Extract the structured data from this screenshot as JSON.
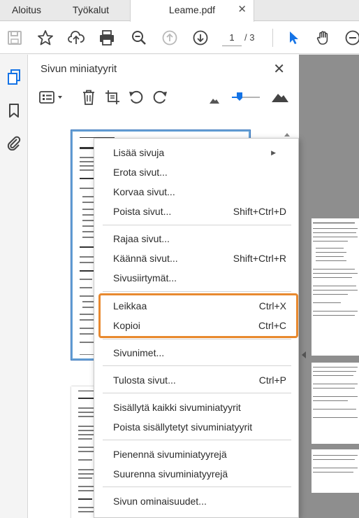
{
  "tabs": {
    "home": "Aloitus",
    "tools": "Työkalut",
    "document": "Leame.pdf",
    "close": "✕"
  },
  "toolbar": {
    "icons": [
      "save-icon",
      "star-icon",
      "upload-icon",
      "print-icon",
      "zoom-out-icon",
      "page-up-icon",
      "page-down-icon",
      "select-cursor-icon",
      "hand-icon",
      "zoom-minus-icon"
    ],
    "page_current": "1",
    "page_total": "/ 3",
    "accent": "#1473e6"
  },
  "panel": {
    "title": "Sivun miniatyyrit",
    "close": "✕",
    "tools": [
      "options-icon",
      "delete-icon",
      "crop-icon",
      "rotate-ccw-icon",
      "rotate-cw-icon",
      "small-mountain-icon",
      "zoom-slider",
      "large-mountain-icon"
    ],
    "zoom_level": 0.25
  },
  "menu": {
    "items": [
      {
        "label": "Lisää sivuja",
        "shortcut": "",
        "submenu": true
      },
      {
        "label": "Erota sivut...",
        "shortcut": ""
      },
      {
        "label": "Korvaa sivut...",
        "shortcut": ""
      },
      {
        "label": "Poista sivut...",
        "shortcut": "Shift+Ctrl+D"
      },
      {
        "label": "Rajaa sivut...",
        "shortcut": ""
      },
      {
        "label": "Käännä sivut...",
        "shortcut": "Shift+Ctrl+R"
      },
      {
        "label": "Sivusiirtymät...",
        "shortcut": ""
      },
      {
        "label": "Leikkaa",
        "shortcut": "Ctrl+X"
      },
      {
        "label": "Kopioi",
        "shortcut": "Ctrl+C"
      },
      {
        "label": "Sivunimet...",
        "shortcut": ""
      },
      {
        "label": "Tulosta sivut...",
        "shortcut": "Ctrl+P"
      },
      {
        "label": "Sisällytä kaikki sivuminiatyyrit",
        "shortcut": ""
      },
      {
        "label": "Poista sisällytetyt sivuminiatyyrit",
        "shortcut": ""
      },
      {
        "label": "Pienennä sivuminiatyyrejä",
        "shortcut": ""
      },
      {
        "label": "Suurenna sivuminiatyyrejä",
        "shortcut": ""
      },
      {
        "label": "Sivun ominaisuudet...",
        "shortcut": ""
      }
    ],
    "highlight_color": "#e8892f"
  }
}
